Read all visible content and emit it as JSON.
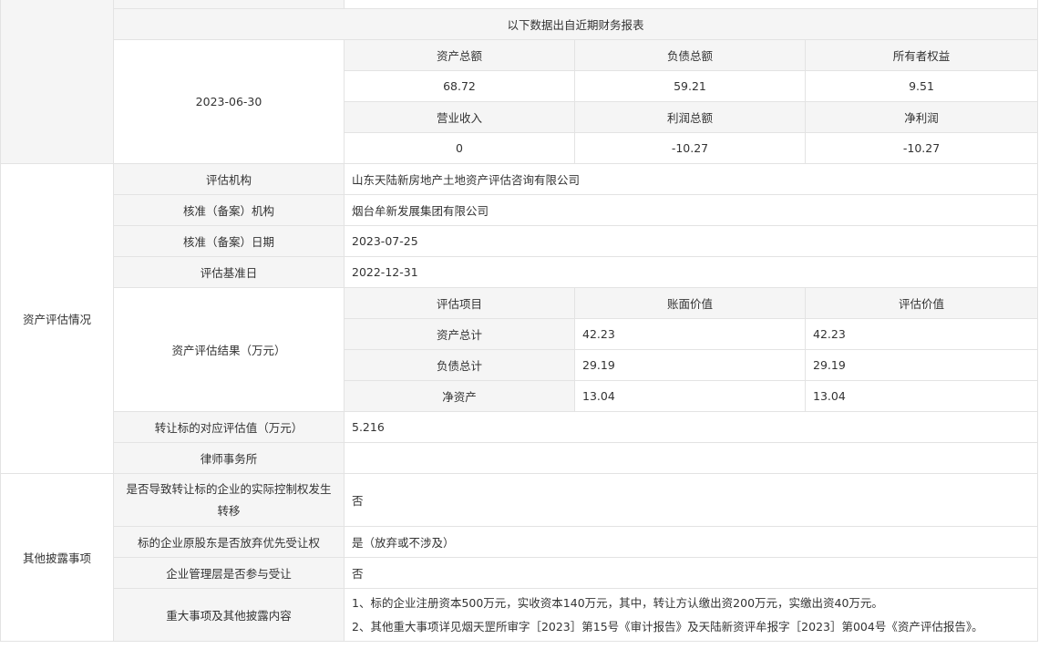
{
  "fin": {
    "header": "以下数据出自近期财务报表",
    "date": "2023-06-30",
    "h1": [
      "资产总额",
      "负债总额",
      "所有者权益"
    ],
    "v1": [
      "68.72",
      "59.21",
      "9.51"
    ],
    "h2": [
      "营业收入",
      "利润总额",
      "净利润"
    ],
    "v2": [
      "0",
      "-10.27",
      "-10.27"
    ]
  },
  "valuation": {
    "section": "资产评估情况",
    "agency_label": "评估机构",
    "agency": "山东天陆新房地产土地资产评估咨询有限公司",
    "approve_org_label": "核准（备案）机构",
    "approve_org": "烟台牟新发展集团有限公司",
    "approve_date_label": "核准（备案）日期",
    "approve_date": "2023-07-25",
    "base_date_label": "评估基准日",
    "base_date": "2022-12-31",
    "result_label": "资产评估结果（万元）",
    "result_headers": [
      "评估项目",
      "账面价值",
      "评估价值"
    ],
    "result_rows": [
      {
        "item": "资产总计",
        "book": "42.23",
        "appraised": "42.23"
      },
      {
        "item": "负债总计",
        "book": "29.19",
        "appraised": "29.19"
      },
      {
        "item": "净资产",
        "book": "13.04",
        "appraised": "13.04"
      }
    ],
    "target_value_label": "转让标的对应评估值（万元）",
    "target_value": "5.216",
    "law_firm_label": "律师事务所",
    "law_firm": ""
  },
  "other": {
    "section": "其他披露事项",
    "control_label": "是否导致转让标的企业的实际控制权发生转移",
    "control": "否",
    "waive_label": "标的企业原股东是否放弃优先受让权",
    "waive": "是（放弃或不涉及）",
    "mgmt_label": "企业管理层是否参与受让",
    "mgmt": "否",
    "major_label": "重大事项及其他披露内容",
    "major_lines": [
      "1、标的企业注册资本500万元，实收资本140万元，其中，转让方认缴出资200万元，实缴出资40万元。",
      "2、其他重大事项详见烟天罡所审字［2023］第15号《审计报告》及天陆新资评牟报字［2023］第004号《资产评估报告》。"
    ]
  }
}
